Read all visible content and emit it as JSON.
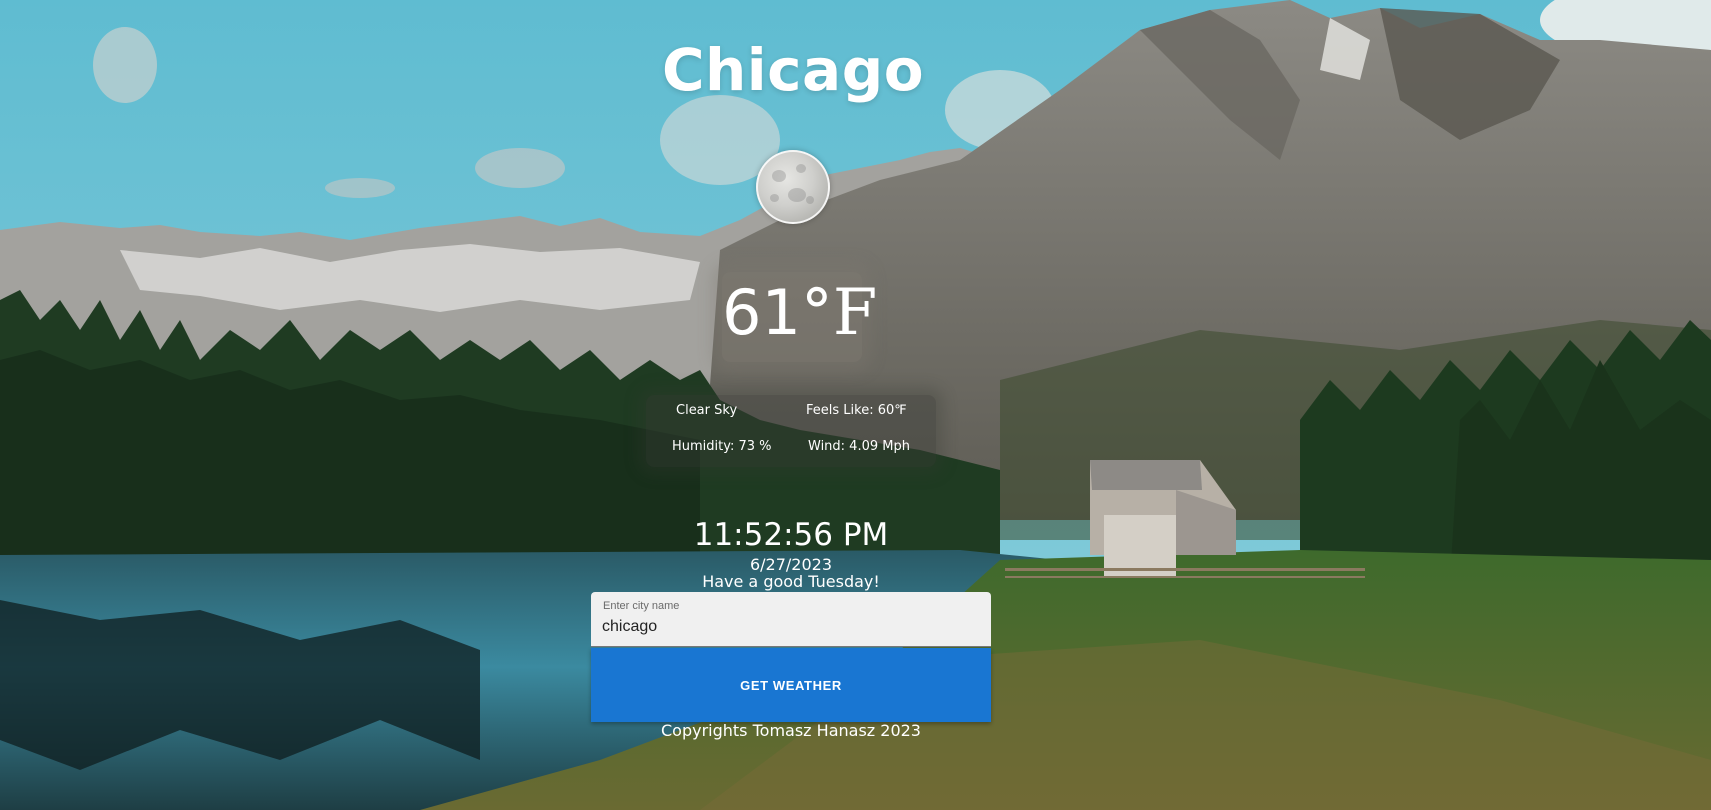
{
  "city": "Chicago",
  "weather": {
    "icon": "full-moon-icon",
    "temperature_value": "61",
    "temperature_unit": "°F",
    "condition": "Clear Sky",
    "feels_like": "Feels Like: 60℉",
    "humidity": "Humidity: 73 %",
    "wind": "Wind: 4.09 Mph"
  },
  "clock": {
    "time": "11:52:56 PM",
    "date": "6/27/2023",
    "greeting": "Have a good Tuesday!"
  },
  "search": {
    "label": "Enter city name",
    "value": "chicago"
  },
  "button": {
    "label": "GET WEATHER"
  },
  "footer": {
    "text": "Copyrights Tomasz Hanasz 2023"
  },
  "colors": {
    "sky": "#6cc3d6",
    "button": "#1976d2",
    "input_bg": "#f0f0f0",
    "text": "#ffffff"
  }
}
